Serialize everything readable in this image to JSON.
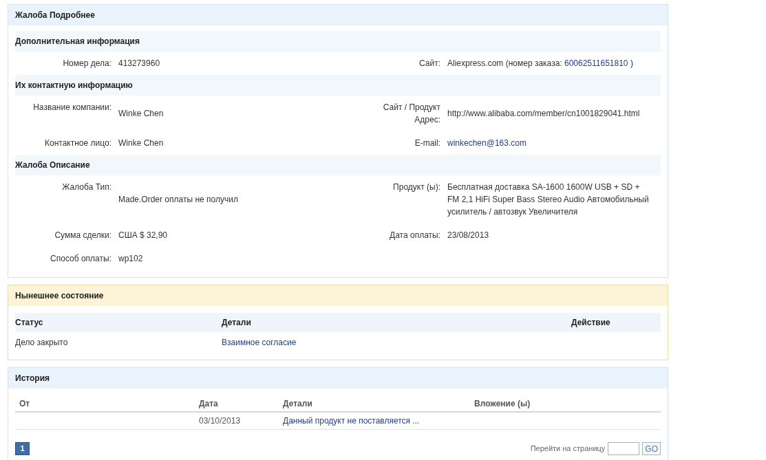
{
  "details": {
    "title": "Жалоба Подробнее",
    "sections": [
      {
        "title": "Дополнительная информация",
        "rows": [
          {
            "left": {
              "label": "Номер дела:",
              "value": [
                {
                  "kind": "text",
                  "text": "413273960"
                }
              ]
            },
            "right": {
              "label": "Сайт:",
              "value": [
                {
                  "kind": "text",
                  "text": "Aliexpress.com (номер заказа: "
                },
                {
                  "kind": "link",
                  "text": "60062511651810"
                },
                {
                  "kind": "text",
                  "text": " )"
                }
              ]
            }
          }
        ]
      },
      {
        "title": "Их контактную информацию",
        "rows": [
          {
            "left": {
              "label": "Название компании:",
              "value": [
                {
                  "kind": "text",
                  "text": "Winke Chen"
                }
              ]
            },
            "right": {
              "label": "Сайт / Продукт Адрес:",
              "value": [
                {
                  "kind": "text",
                  "text": "http://www.alibaba.com/member/cn1001829041.html"
                }
              ]
            }
          },
          {
            "left": {
              "label": "Контактное лицо:",
              "value": [
                {
                  "kind": "text",
                  "text": "Winke Chen"
                }
              ]
            },
            "right": {
              "label": "E-mail:",
              "value": [
                {
                  "kind": "link",
                  "text": "winkechen@163.com"
                }
              ]
            }
          }
        ]
      },
      {
        "title": "Жалоба Описание",
        "rows": [
          {
            "left": {
              "label": "Жалоба Тип:",
              "value": [
                {
                  "kind": "text",
                  "text": "Made.Order оплаты не получил"
                }
              ]
            },
            "right": {
              "label": "Продукт (ы):",
              "value": [
                {
                  "kind": "text",
                  "text": "Бесплатная доставка SA-1600 1600W USB + SD + FM 2,1 HiFi Super Bass Stereo Audio Автомобильный усилитель / автозвук Увеличителя"
                }
              ]
            }
          },
          {
            "left": {
              "label": "Сумма сделки:",
              "value": [
                {
                  "kind": "text",
                  "text": "США $ 32,90"
                }
              ]
            },
            "right": {
              "label": "Дата оплаты:",
              "value": [
                {
                  "kind": "text",
                  "text": "23/08/2013"
                }
              ]
            }
          },
          {
            "left": {
              "label": "Способ оплаты:",
              "value": [
                {
                  "kind": "text",
                  "text": "wp102"
                }
              ]
            }
          }
        ]
      }
    ]
  },
  "status": {
    "title": "Нынешнее состояние",
    "columns": [
      "Статус",
      "Детали",
      "Действие"
    ],
    "rows": [
      {
        "status": "Дело закрыто",
        "details": "Взаимное согласие"
      }
    ]
  },
  "history": {
    "title": "История",
    "columns": [
      "От",
      "Дата",
      "Детали",
      "Вложение (ы)"
    ],
    "rows": [
      {
        "date": "03/10/2013",
        "details": "Данный продукт не поставляется ..."
      }
    ],
    "pages": [
      {
        "label": "1",
        "selected": true
      }
    ],
    "goto_label": "Перейти на страницу",
    "go_button": "GO"
  }
}
